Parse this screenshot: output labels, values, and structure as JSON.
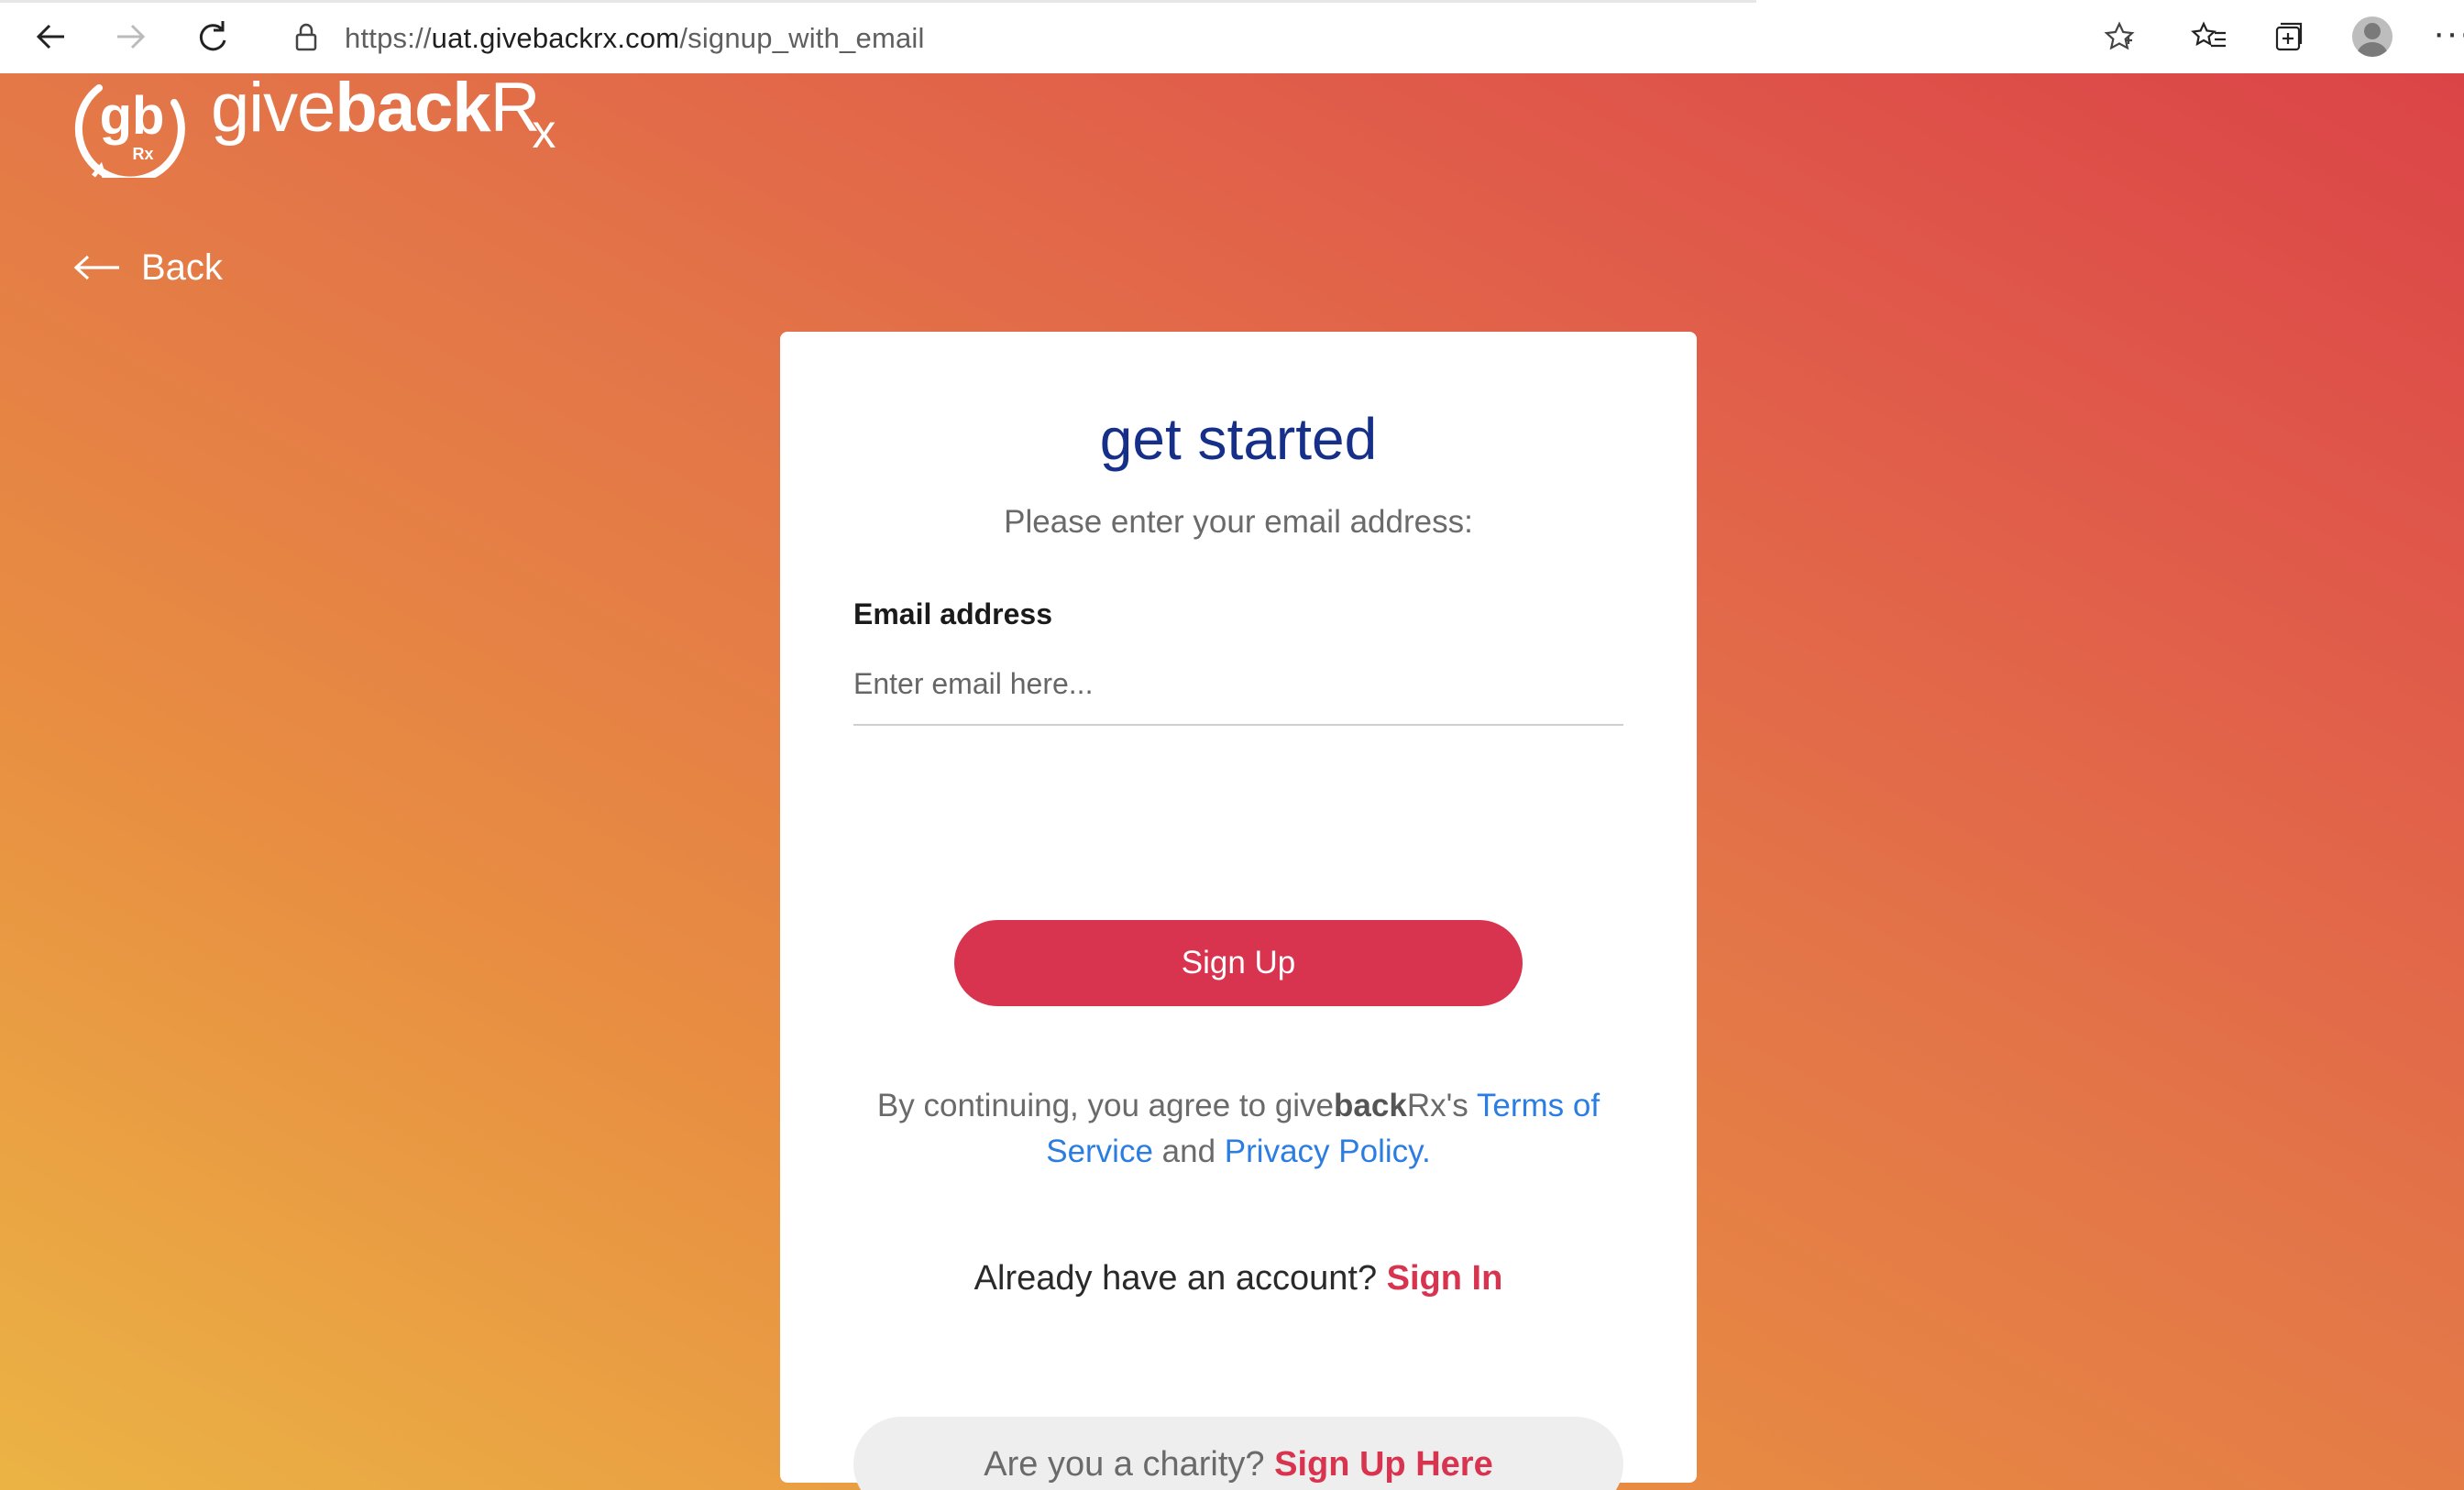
{
  "browser": {
    "url_prefix": "https://",
    "url_host": "uat.givebackrx.com",
    "url_path": "/signup_with_email",
    "more_label": "···",
    "icons": [
      "back-arrow-icon",
      "forward-arrow-icon",
      "refresh-icon",
      "lock-icon",
      "star-icon",
      "favorites-icon",
      "collections-icon",
      "profile-avatar"
    ]
  },
  "brand": {
    "mark_text": "gb",
    "mark_sub": "Rx",
    "name_regular": "give",
    "name_bold": "back",
    "name_r": "R",
    "name_x": "x"
  },
  "nav": {
    "back_label": "Back"
  },
  "form": {
    "title": "get started",
    "subtitle": "Please enter your email address:",
    "email_label": "Email address",
    "email_placeholder": "Enter email here...",
    "email_value": "",
    "submit_label": "Sign Up"
  },
  "terms": {
    "prefix": "By continuing, you agree to give",
    "brand_bold": "back",
    "brand_suffix": "Rx's ",
    "tos_label": "Terms of Service",
    "conjunction": " and ",
    "privacy_label": "Privacy Policy."
  },
  "signin": {
    "prompt": "Already have an account? ",
    "link_label": "Sign In"
  },
  "charity": {
    "prompt": "Are you a charity? ",
    "link_label": "Sign Up Here"
  },
  "colors": {
    "primary_red": "#d9344f",
    "title_blue": "#16308a",
    "link_blue": "#2b7de1",
    "gradient_start": "#ebb344",
    "gradient_end": "#db4447"
  }
}
